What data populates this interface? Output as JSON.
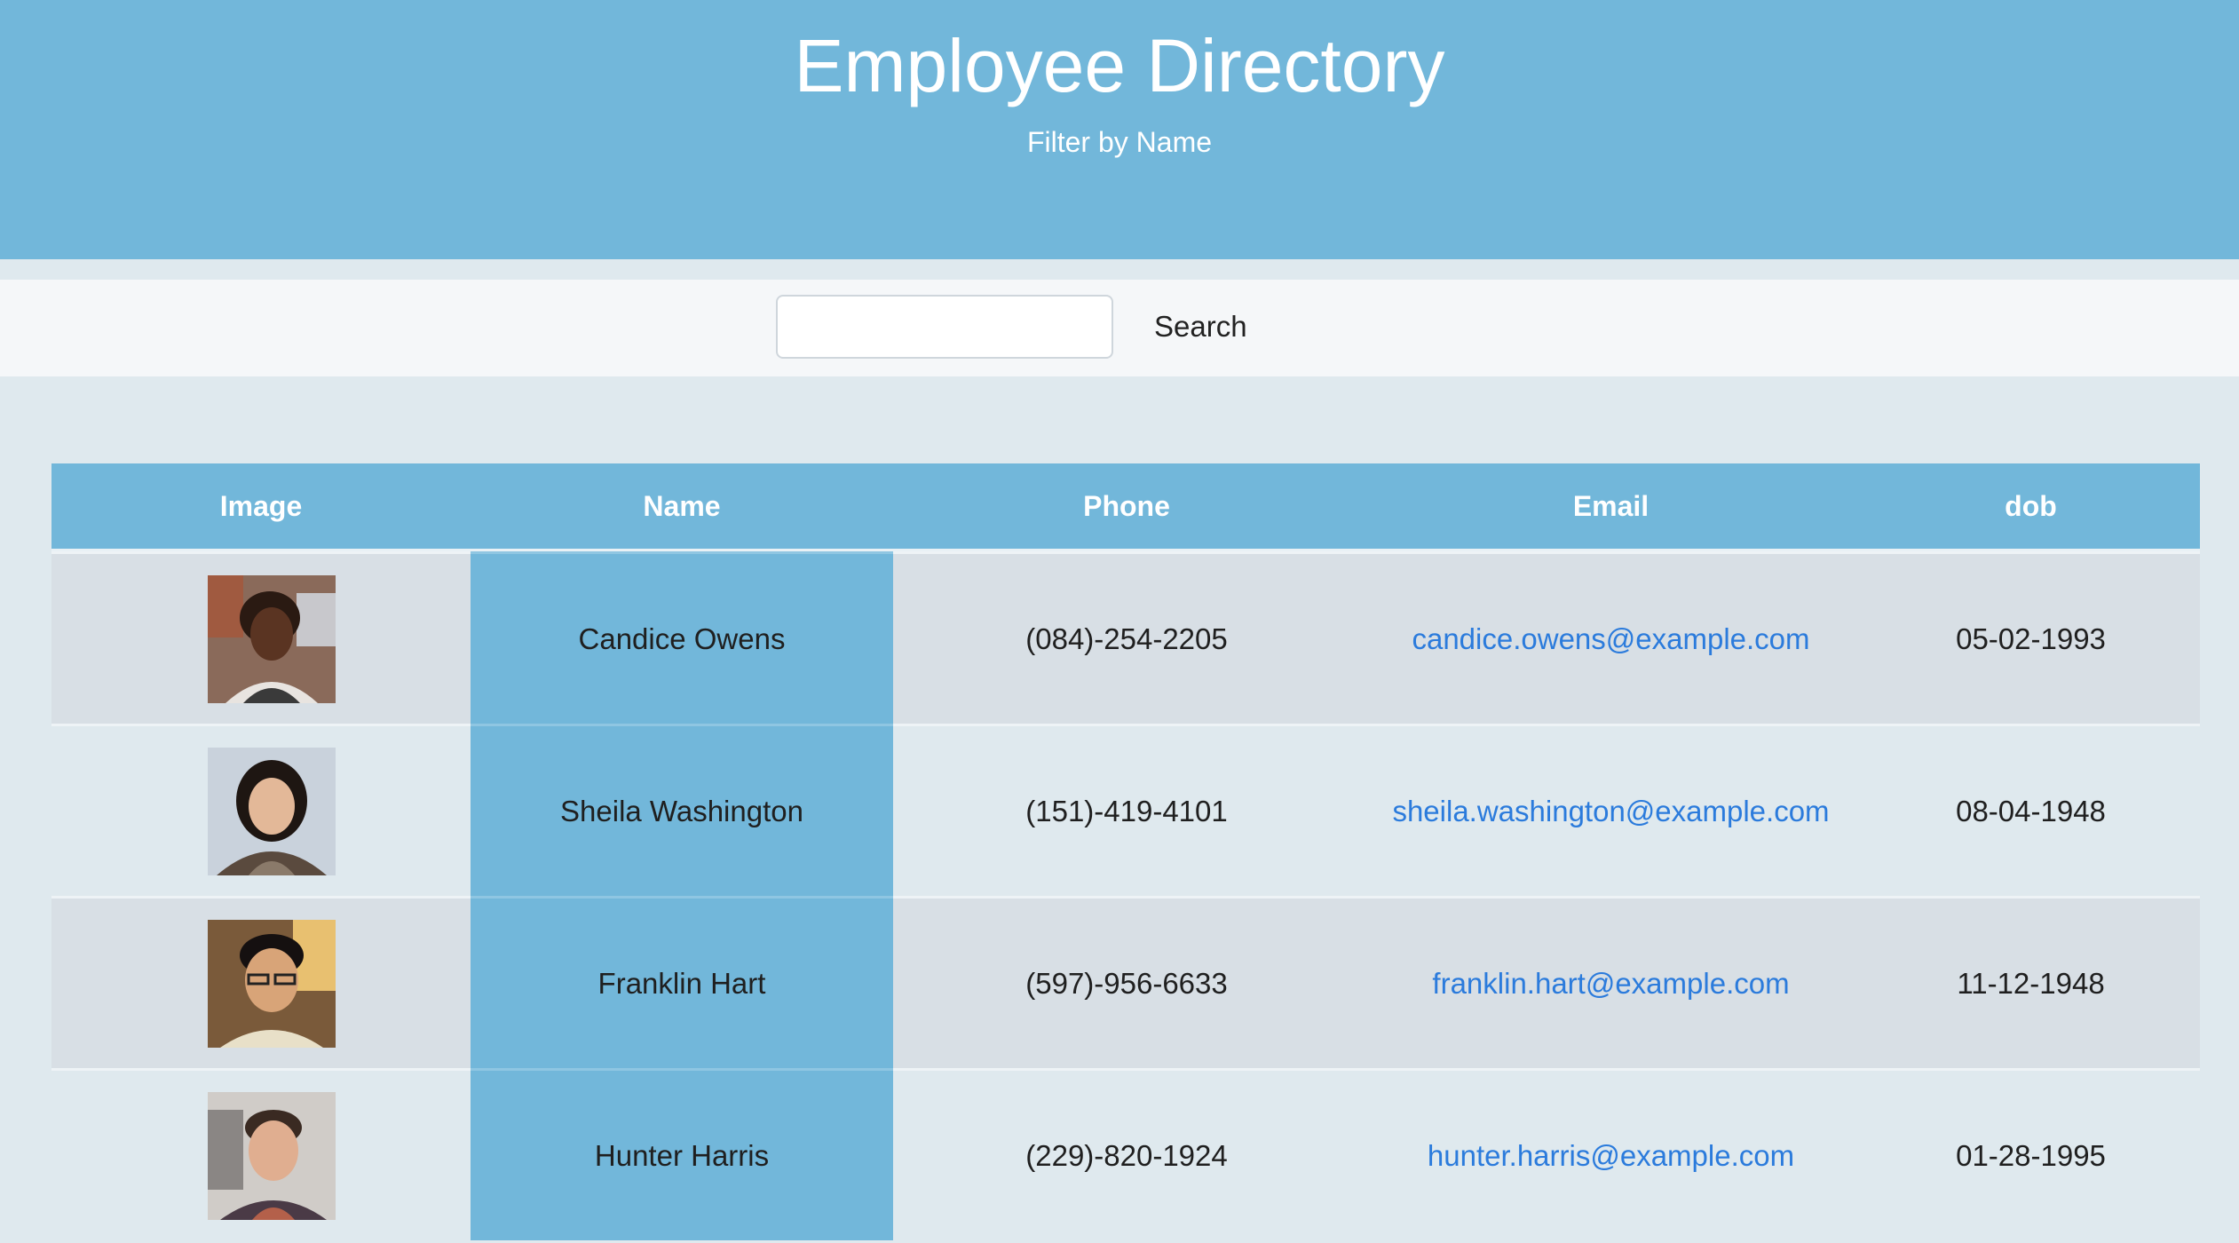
{
  "header": {
    "title": "Employee Directory",
    "subtitle": "Filter by Name"
  },
  "search": {
    "value": "",
    "placeholder": "",
    "button_label": "Search"
  },
  "table": {
    "columns": [
      "Image",
      "Name",
      "Phone",
      "Email",
      "dob"
    ],
    "rows": [
      {
        "name": "Candice Owens",
        "phone": "(084)-254-2205",
        "email": "candice.owens@example.com",
        "dob": "05-02-1993"
      },
      {
        "name": "Sheila Washington",
        "phone": "(151)-419-4101",
        "email": "sheila.washington@example.com",
        "dob": "08-04-1948"
      },
      {
        "name": "Franklin Hart",
        "phone": "(597)-956-6633",
        "email": "franklin.hart@example.com",
        "dob": "11-12-1948"
      },
      {
        "name": "Hunter Harris",
        "phone": "(229)-820-1924",
        "email": "hunter.harris@example.com",
        "dob": "01-28-1995"
      }
    ]
  },
  "colors": {
    "header_bg": "#72b7da",
    "page_bg": "#dfe9ee",
    "link": "#2b7bdc"
  }
}
